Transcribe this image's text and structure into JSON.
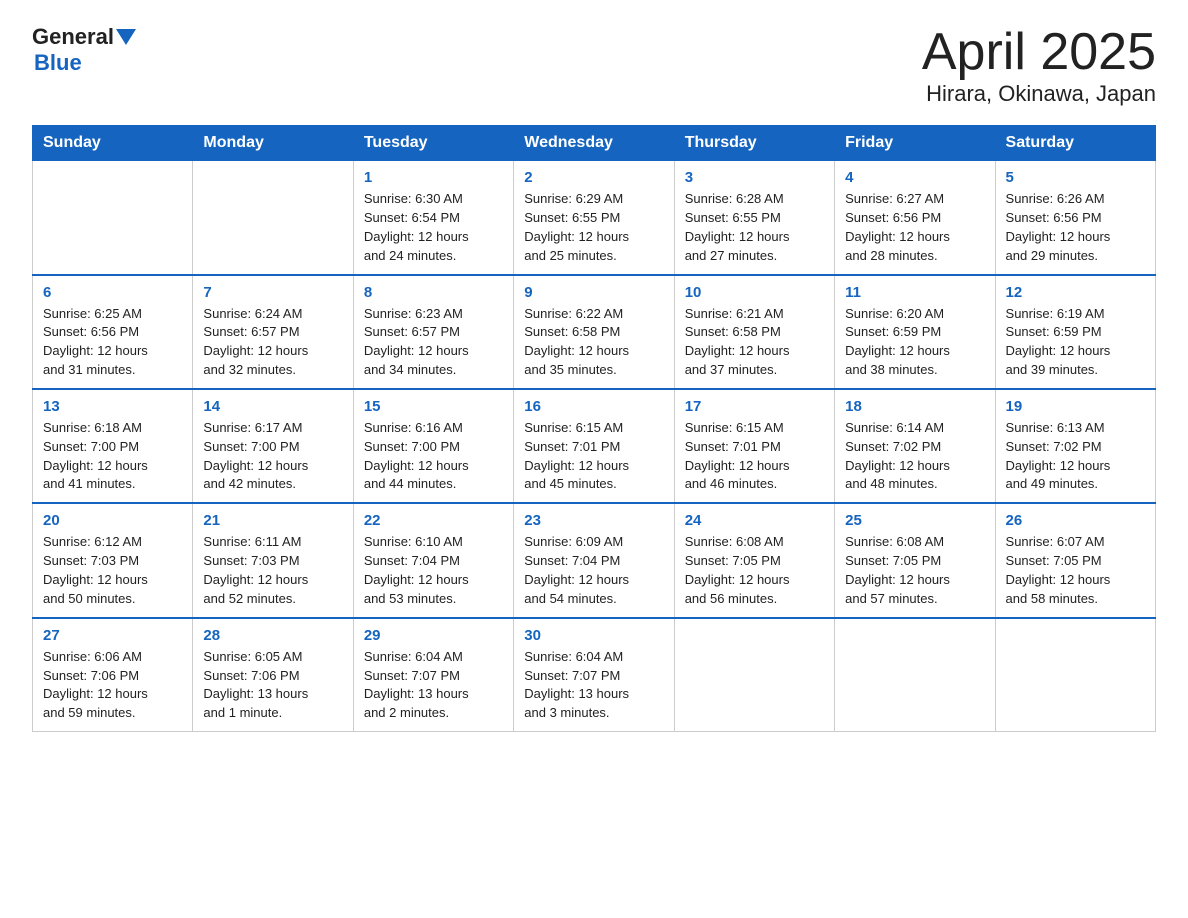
{
  "header": {
    "logo_general": "General",
    "logo_blue": "Blue",
    "title": "April 2025",
    "location": "Hirara, Okinawa, Japan"
  },
  "calendar": {
    "days_of_week": [
      "Sunday",
      "Monday",
      "Tuesday",
      "Wednesday",
      "Thursday",
      "Friday",
      "Saturday"
    ],
    "weeks": [
      [
        {
          "day": "",
          "info": ""
        },
        {
          "day": "",
          "info": ""
        },
        {
          "day": "1",
          "info": "Sunrise: 6:30 AM\nSunset: 6:54 PM\nDaylight: 12 hours\nand 24 minutes."
        },
        {
          "day": "2",
          "info": "Sunrise: 6:29 AM\nSunset: 6:55 PM\nDaylight: 12 hours\nand 25 minutes."
        },
        {
          "day": "3",
          "info": "Sunrise: 6:28 AM\nSunset: 6:55 PM\nDaylight: 12 hours\nand 27 minutes."
        },
        {
          "day": "4",
          "info": "Sunrise: 6:27 AM\nSunset: 6:56 PM\nDaylight: 12 hours\nand 28 minutes."
        },
        {
          "day": "5",
          "info": "Sunrise: 6:26 AM\nSunset: 6:56 PM\nDaylight: 12 hours\nand 29 minutes."
        }
      ],
      [
        {
          "day": "6",
          "info": "Sunrise: 6:25 AM\nSunset: 6:56 PM\nDaylight: 12 hours\nand 31 minutes."
        },
        {
          "day": "7",
          "info": "Sunrise: 6:24 AM\nSunset: 6:57 PM\nDaylight: 12 hours\nand 32 minutes."
        },
        {
          "day": "8",
          "info": "Sunrise: 6:23 AM\nSunset: 6:57 PM\nDaylight: 12 hours\nand 34 minutes."
        },
        {
          "day": "9",
          "info": "Sunrise: 6:22 AM\nSunset: 6:58 PM\nDaylight: 12 hours\nand 35 minutes."
        },
        {
          "day": "10",
          "info": "Sunrise: 6:21 AM\nSunset: 6:58 PM\nDaylight: 12 hours\nand 37 minutes."
        },
        {
          "day": "11",
          "info": "Sunrise: 6:20 AM\nSunset: 6:59 PM\nDaylight: 12 hours\nand 38 minutes."
        },
        {
          "day": "12",
          "info": "Sunrise: 6:19 AM\nSunset: 6:59 PM\nDaylight: 12 hours\nand 39 minutes."
        }
      ],
      [
        {
          "day": "13",
          "info": "Sunrise: 6:18 AM\nSunset: 7:00 PM\nDaylight: 12 hours\nand 41 minutes."
        },
        {
          "day": "14",
          "info": "Sunrise: 6:17 AM\nSunset: 7:00 PM\nDaylight: 12 hours\nand 42 minutes."
        },
        {
          "day": "15",
          "info": "Sunrise: 6:16 AM\nSunset: 7:00 PM\nDaylight: 12 hours\nand 44 minutes."
        },
        {
          "day": "16",
          "info": "Sunrise: 6:15 AM\nSunset: 7:01 PM\nDaylight: 12 hours\nand 45 minutes."
        },
        {
          "day": "17",
          "info": "Sunrise: 6:15 AM\nSunset: 7:01 PM\nDaylight: 12 hours\nand 46 minutes."
        },
        {
          "day": "18",
          "info": "Sunrise: 6:14 AM\nSunset: 7:02 PM\nDaylight: 12 hours\nand 48 minutes."
        },
        {
          "day": "19",
          "info": "Sunrise: 6:13 AM\nSunset: 7:02 PM\nDaylight: 12 hours\nand 49 minutes."
        }
      ],
      [
        {
          "day": "20",
          "info": "Sunrise: 6:12 AM\nSunset: 7:03 PM\nDaylight: 12 hours\nand 50 minutes."
        },
        {
          "day": "21",
          "info": "Sunrise: 6:11 AM\nSunset: 7:03 PM\nDaylight: 12 hours\nand 52 minutes."
        },
        {
          "day": "22",
          "info": "Sunrise: 6:10 AM\nSunset: 7:04 PM\nDaylight: 12 hours\nand 53 minutes."
        },
        {
          "day": "23",
          "info": "Sunrise: 6:09 AM\nSunset: 7:04 PM\nDaylight: 12 hours\nand 54 minutes."
        },
        {
          "day": "24",
          "info": "Sunrise: 6:08 AM\nSunset: 7:05 PM\nDaylight: 12 hours\nand 56 minutes."
        },
        {
          "day": "25",
          "info": "Sunrise: 6:08 AM\nSunset: 7:05 PM\nDaylight: 12 hours\nand 57 minutes."
        },
        {
          "day": "26",
          "info": "Sunrise: 6:07 AM\nSunset: 7:05 PM\nDaylight: 12 hours\nand 58 minutes."
        }
      ],
      [
        {
          "day": "27",
          "info": "Sunrise: 6:06 AM\nSunset: 7:06 PM\nDaylight: 12 hours\nand 59 minutes."
        },
        {
          "day": "28",
          "info": "Sunrise: 6:05 AM\nSunset: 7:06 PM\nDaylight: 13 hours\nand 1 minute."
        },
        {
          "day": "29",
          "info": "Sunrise: 6:04 AM\nSunset: 7:07 PM\nDaylight: 13 hours\nand 2 minutes."
        },
        {
          "day": "30",
          "info": "Sunrise: 6:04 AM\nSunset: 7:07 PM\nDaylight: 13 hours\nand 3 minutes."
        },
        {
          "day": "",
          "info": ""
        },
        {
          "day": "",
          "info": ""
        },
        {
          "day": "",
          "info": ""
        }
      ]
    ]
  }
}
